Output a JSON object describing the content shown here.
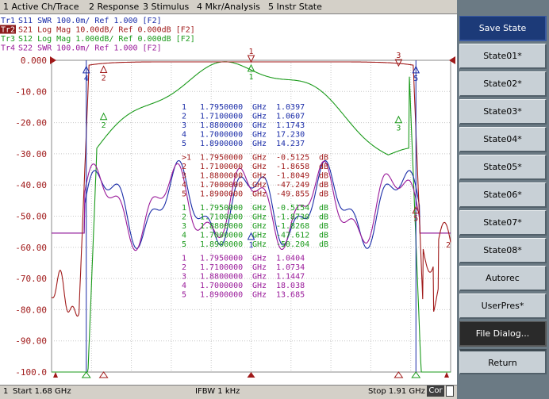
{
  "menu": [
    "1 Active Ch/Trace",
    "2 Response",
    "3 Stimulus",
    "4 Mkr/Analysis",
    "5 Instr State"
  ],
  "trace_headers": [
    {
      "label": "Tr1",
      "text": "S11  SWR 100.0m/ Ref 1.000  [F2]",
      "color": "#1a2ca8",
      "active": false
    },
    {
      "label": "Tr2",
      "text": "S21  Log Mag 10.00dB/ Ref 0.000dB  [F2]",
      "color": "#a01a1a",
      "active": true
    },
    {
      "label": "Tr3",
      "text": "S12  Log Mag 1.000dB/ Ref 0.000dB  [F2]",
      "color": "#1a9a1a",
      "active": false
    },
    {
      "label": "Tr4",
      "text": "S22  SWR 100.0m/ Ref 1.000  [F2]",
      "color": "#9a1a9a",
      "active": false
    }
  ],
  "y_ticks": [
    "0.000",
    "-10.00",
    "-20.00",
    "-30.00",
    "-40.00",
    "-50.00",
    "-60.00",
    "-70.00",
    "-80.00",
    "-90.00",
    "-100.0"
  ],
  "marker_tables": [
    {
      "color": "#1a2ca8",
      "rows": [
        {
          "id": "1",
          "freq": "1.7950000",
          "unit": "GHz",
          "val": " 1.0397",
          "vunit": ""
        },
        {
          "id": "2",
          "freq": "1.7100000",
          "unit": "GHz",
          "val": " 1.0607",
          "vunit": ""
        },
        {
          "id": "3",
          "freq": "1.8800000",
          "unit": "GHz",
          "val": " 1.1743",
          "vunit": ""
        },
        {
          "id": "4",
          "freq": "1.7000000",
          "unit": "GHz",
          "val": " 17.230",
          "vunit": ""
        },
        {
          "id": "5",
          "freq": "1.8900000",
          "unit": "GHz",
          "val": " 14.237",
          "vunit": ""
        }
      ]
    },
    {
      "color": "#a01a1a",
      "rows": [
        {
          "id": ">1",
          "freq": "1.7950000",
          "unit": "GHz",
          "val": "-0.5125",
          "vunit": "dB"
        },
        {
          "id": "2",
          "freq": "1.7100000",
          "unit": "GHz",
          "val": "-1.8658",
          "vunit": "dB"
        },
        {
          "id": "3",
          "freq": "1.8800000",
          "unit": "GHz",
          "val": "-1.8049",
          "vunit": "dB"
        },
        {
          "id": "4",
          "freq": "1.7000000",
          "unit": "GHz",
          "val": "-47.249",
          "vunit": "dB"
        },
        {
          "id": "5",
          "freq": "1.8900000",
          "unit": "GHz",
          "val": "-49.855",
          "vunit": "dB"
        }
      ]
    },
    {
      "color": "#1a9a1a",
      "rows": [
        {
          "id": "1",
          "freq": "1.7950000",
          "unit": "GHz",
          "val": "-0.5154",
          "vunit": "dB"
        },
        {
          "id": "2",
          "freq": "1.7100000",
          "unit": "GHz",
          "val": "-1.8730",
          "vunit": "dB"
        },
        {
          "id": "3",
          "freq": "1.8800000",
          "unit": "GHz",
          "val": "-1.8268",
          "vunit": "dB"
        },
        {
          "id": "4",
          "freq": "1.7000000",
          "unit": "GHz",
          "val": "-47.612",
          "vunit": "dB"
        },
        {
          "id": "5",
          "freq": "1.8900000",
          "unit": "GHz",
          "val": "-50.204",
          "vunit": "dB"
        }
      ]
    },
    {
      "color": "#9a1a9a",
      "rows": [
        {
          "id": "1",
          "freq": "1.7950000",
          "unit": "GHz",
          "val": " 1.0404",
          "vunit": ""
        },
        {
          "id": "2",
          "freq": "1.7100000",
          "unit": "GHz",
          "val": " 1.0734",
          "vunit": ""
        },
        {
          "id": "3",
          "freq": "1.8800000",
          "unit": "GHz",
          "val": " 1.1447",
          "vunit": ""
        },
        {
          "id": "4",
          "freq": "1.7000000",
          "unit": "GHz",
          "val": " 18.038",
          "vunit": ""
        },
        {
          "id": "5",
          "freq": "1.8900000",
          "unit": "GHz",
          "val": " 13.685",
          "vunit": ""
        }
      ]
    }
  ],
  "status": {
    "channel": "1",
    "start": "Start 1.68 GHz",
    "ifbw": "IFBW 1 kHz",
    "stop": "Stop 1.91 GHz",
    "cor": "Cor"
  },
  "softkeys": [
    "Save State",
    "State01*",
    "State02*",
    "State03*",
    "State04*",
    "State05*",
    "State06*",
    "State07*",
    "State08*",
    "Autorec",
    "UserPres*",
    "File Dialog...",
    "Return"
  ],
  "colors": {
    "s11": "#1a2ca8",
    "s21": "#a01a1a",
    "s12": "#1a9a1a",
    "s22": "#9a1a9a",
    "grid": "#c8c8c8"
  }
}
